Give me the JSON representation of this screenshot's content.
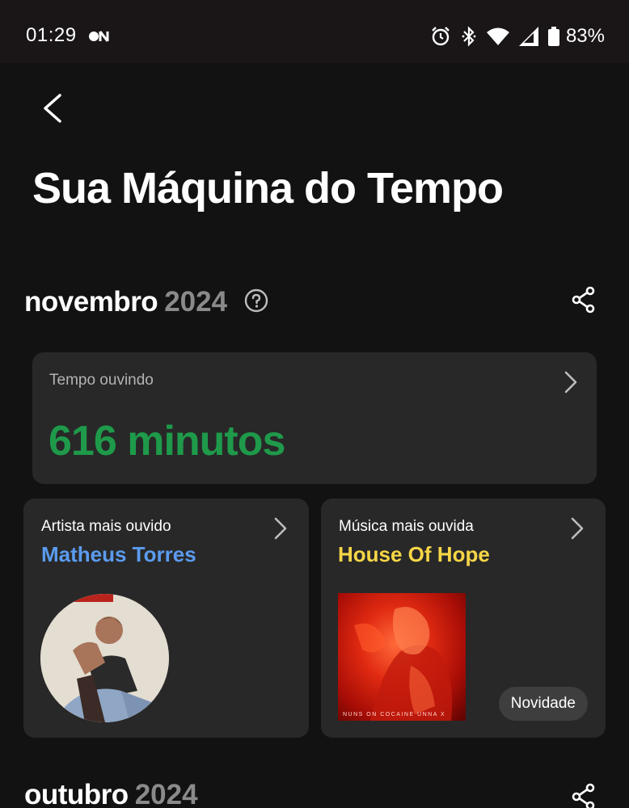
{
  "status_bar": {
    "time": "01:29",
    "battery": "83%",
    "icons": [
      "on-icon",
      "alarm-icon",
      "bluetooth-icon",
      "wifi-icon",
      "signal-icon",
      "battery-icon"
    ]
  },
  "header": {
    "title": "Sua Máquina do Tempo",
    "back_icon": "chevron-left-icon"
  },
  "months": [
    {
      "name": "novembro",
      "year": "2024",
      "listening_time": {
        "label": "Tempo ouvindo",
        "value": "616 minutos"
      },
      "top_artist": {
        "label": "Artista mais ouvido",
        "name": "Matheus Torres"
      },
      "top_song": {
        "label": "Música mais ouvida",
        "name": "House Of Hope",
        "cover_text": "NUNS ON COCAINE  UNNA X",
        "badge": "Novidade"
      }
    },
    {
      "name": "outubro",
      "year": "2024"
    }
  ],
  "colors": {
    "background": "#121212",
    "card": "#282828",
    "minutes_green": "#1e9a4a",
    "artist_blue": "#5b9bef",
    "song_yellow": "#f6d647",
    "year_gray": "#8a8a8a"
  }
}
